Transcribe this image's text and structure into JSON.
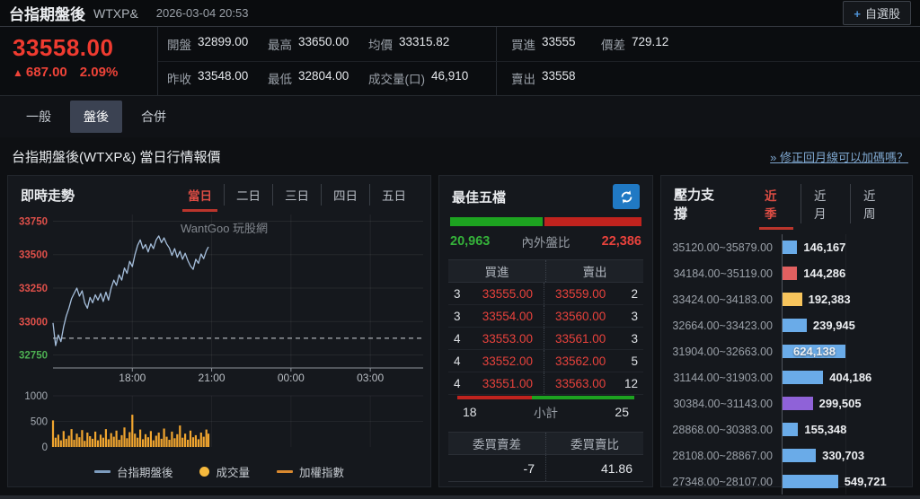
{
  "topbar": {
    "title": "台指期盤後",
    "symbol": "WTXP&",
    "datetime": "2026-03-04 20:53",
    "watchlist_button": {
      "plus": "+",
      "label": "自選股"
    }
  },
  "quote": {
    "last": "33558.00",
    "arrow": "▲",
    "change": "687.00",
    "change_pct": "2.09%",
    "row1": [
      {
        "label": "開盤",
        "value": "32899.00"
      },
      {
        "label": "最高",
        "value": "33650.00"
      },
      {
        "label": "均價",
        "value": "33315.82"
      }
    ],
    "row1b": [
      {
        "label": "買進",
        "value": "33555"
      },
      {
        "label": "價差",
        "value": "729.12"
      }
    ],
    "row2": [
      {
        "label": "昨收",
        "value": "33548.00"
      },
      {
        "label": "最低",
        "value": "32804.00"
      },
      {
        "label": "成交量(口)",
        "value": "46,910"
      }
    ],
    "row2b": [
      {
        "label": "賣出",
        "value": "33558"
      }
    ]
  },
  "tabs": {
    "items": [
      "一般",
      "盤後",
      "合併"
    ],
    "active_index": 1
  },
  "section": {
    "title": "台指期盤後(WTXP&) 當日行情報價",
    "link": "» 修正回月線可以加碼嗎？"
  },
  "chart_panel": {
    "title": "即時走勢",
    "periods": [
      "當日",
      "二日",
      "三日",
      "四日",
      "五日"
    ],
    "active_period": "當日",
    "watermark": "WantGoo 玩股網",
    "legend": [
      {
        "label": "台指期盤後",
        "marker": "line",
        "color": "#7d9cbe"
      },
      {
        "label": "成交量",
        "marker": "dot",
        "color": "#f6b93d"
      },
      {
        "label": "加權指數",
        "marker": "line",
        "color": "#d9892f"
      }
    ]
  },
  "chart_data": [
    {
      "type": "line",
      "title": "即時走勢 (當日)",
      "series_name": "台指期盤後",
      "line_color": "#a6bfdc",
      "x_range_hours": [
        15,
        29
      ],
      "x_ticks": [
        {
          "hour": 18,
          "label": "18:00"
        },
        {
          "hour": 21,
          "label": "21:00"
        },
        {
          "hour": 24,
          "label": "00:00"
        },
        {
          "hour": 27,
          "label": "03:00"
        }
      ],
      "ylim": [
        32700,
        33800
      ],
      "y_ticks": [
        {
          "value": 33750,
          "color": "#e0504a"
        },
        {
          "value": 33500,
          "color": "#e0504a"
        },
        {
          "value": 33250,
          "color": "#e0504a"
        },
        {
          "value": 33000,
          "color": "#e0504a"
        },
        {
          "value": 32750,
          "color": "#4db052"
        }
      ],
      "reference_line": 32875,
      "x_hours": [
        15,
        15.1,
        15.2,
        15.3,
        15.4,
        15.5,
        15.6,
        15.7,
        15.8,
        15.9,
        16,
        16.1,
        16.2,
        16.3,
        16.4,
        16.5,
        16.6,
        16.7,
        16.8,
        16.9,
        17,
        17.1,
        17.2,
        17.3,
        17.4,
        17.5,
        17.6,
        17.7,
        17.8,
        17.9,
        18,
        18.1,
        18.2,
        18.3,
        18.4,
        18.5,
        18.6,
        18.7,
        18.8,
        18.9,
        19,
        19.1,
        19.2,
        19.3,
        19.4,
        19.5,
        19.6,
        19.7,
        19.8,
        19.9,
        20,
        20.1,
        20.2,
        20.3,
        20.4,
        20.5,
        20.6,
        20.7,
        20.8,
        20.88
      ],
      "prices": [
        32990,
        32820,
        32900,
        32850,
        32960,
        33040,
        33100,
        33170,
        33210,
        33250,
        33190,
        33230,
        33140,
        33100,
        33180,
        33140,
        33200,
        33160,
        33210,
        33150,
        33220,
        33160,
        33250,
        33310,
        33270,
        33350,
        33310,
        33400,
        33360,
        33450,
        33410,
        33500,
        33570,
        33610,
        33545,
        33575,
        33520,
        33580,
        33545,
        33610,
        33640,
        33590,
        33625,
        33580,
        33550,
        33495,
        33545,
        33480,
        33525,
        33465,
        33510,
        33455,
        33415,
        33390,
        33465,
        33435,
        33505,
        33470,
        33530,
        33558
      ],
      "volume": {
        "name": "成交量",
        "color": "#f0a52f",
        "ylim": [
          0,
          1000
        ],
        "y_ticks": [
          1000,
          500,
          0
        ],
        "values": [
          520,
          180,
          240,
          130,
          310,
          160,
          220,
          350,
          140,
          260,
          190,
          330,
          120,
          280,
          210,
          160,
          300,
          130,
          240,
          180,
          350,
          150,
          270,
          200,
          320,
          140,
          230,
          380,
          170,
          290,
          630,
          260,
          180,
          340,
          150,
          250,
          190,
          310,
          130,
          220,
          280,
          160,
          360,
          200,
          140,
          300,
          170,
          250,
          420,
          180,
          260,
          140,
          320,
          190,
          230,
          150,
          280,
          200,
          340,
          260
        ]
      }
    },
    {
      "type": "bar",
      "orientation": "horizontal",
      "title": "壓力支撐 (近季)",
      "categories": [
        "35120.00~35879.00",
        "34184.00~35119.00",
        "33424.00~34183.00",
        "32664.00~33423.00",
        "31904.00~32663.00",
        "31144.00~31903.00",
        "30384.00~31143.00",
        "28868.00~30383.00",
        "28108.00~28867.00",
        "27348.00~28107.00"
      ],
      "values": [
        146167,
        144286,
        192383,
        239945,
        624138,
        404186,
        299505,
        155348,
        330703,
        549721
      ],
      "value_labels": [
        "146,167",
        "144,286",
        "192,383",
        "239,945",
        "624,138",
        "404,186",
        "299,505",
        "155,348",
        "330,703",
        "549,721"
      ],
      "bar_colors": [
        "#6aabe8",
        "#e26060",
        "#f7c45c",
        "#6aabe8",
        "#6aabe8",
        "#6aabe8",
        "#8f62d8",
        "#6aabe8",
        "#6aabe8",
        "#6aabe8"
      ],
      "xlim": [
        0,
        700000
      ]
    }
  ],
  "depth_panel": {
    "title": "最佳五檔",
    "ratio": {
      "buy": "20,963",
      "label": "內外盤比",
      "sell": "22,386",
      "buy_pct": 48.4
    },
    "book_headers": [
      "買進",
      "賣出"
    ],
    "book_rows": [
      {
        "bid_vol": "3",
        "bid": "33555.00",
        "ask": "33559.00",
        "ask_vol": "2"
      },
      {
        "bid_vol": "3",
        "bid": "33554.00",
        "ask": "33560.00",
        "ask_vol": "3"
      },
      {
        "bid_vol": "4",
        "bid": "33553.00",
        "ask": "33561.00",
        "ask_vol": "3"
      },
      {
        "bid_vol": "4",
        "bid": "33552.00",
        "ask": "33562.00",
        "ask_vol": "5"
      },
      {
        "bid_vol": "4",
        "bid": "33551.00",
        "ask": "33563.00",
        "ask_vol": "12"
      }
    ],
    "subtotal": {
      "left": "18",
      "label": "小計",
      "right": "25",
      "left_pct": 41.9
    },
    "metrics_headers": [
      "委買賣差",
      "委買賣比"
    ],
    "metrics_values": [
      "-7",
      "41.86"
    ]
  },
  "sr_panel": {
    "title": "壓力支撐",
    "tabs": [
      "近季",
      "近月",
      "近周"
    ],
    "active_tab": "近季"
  }
}
